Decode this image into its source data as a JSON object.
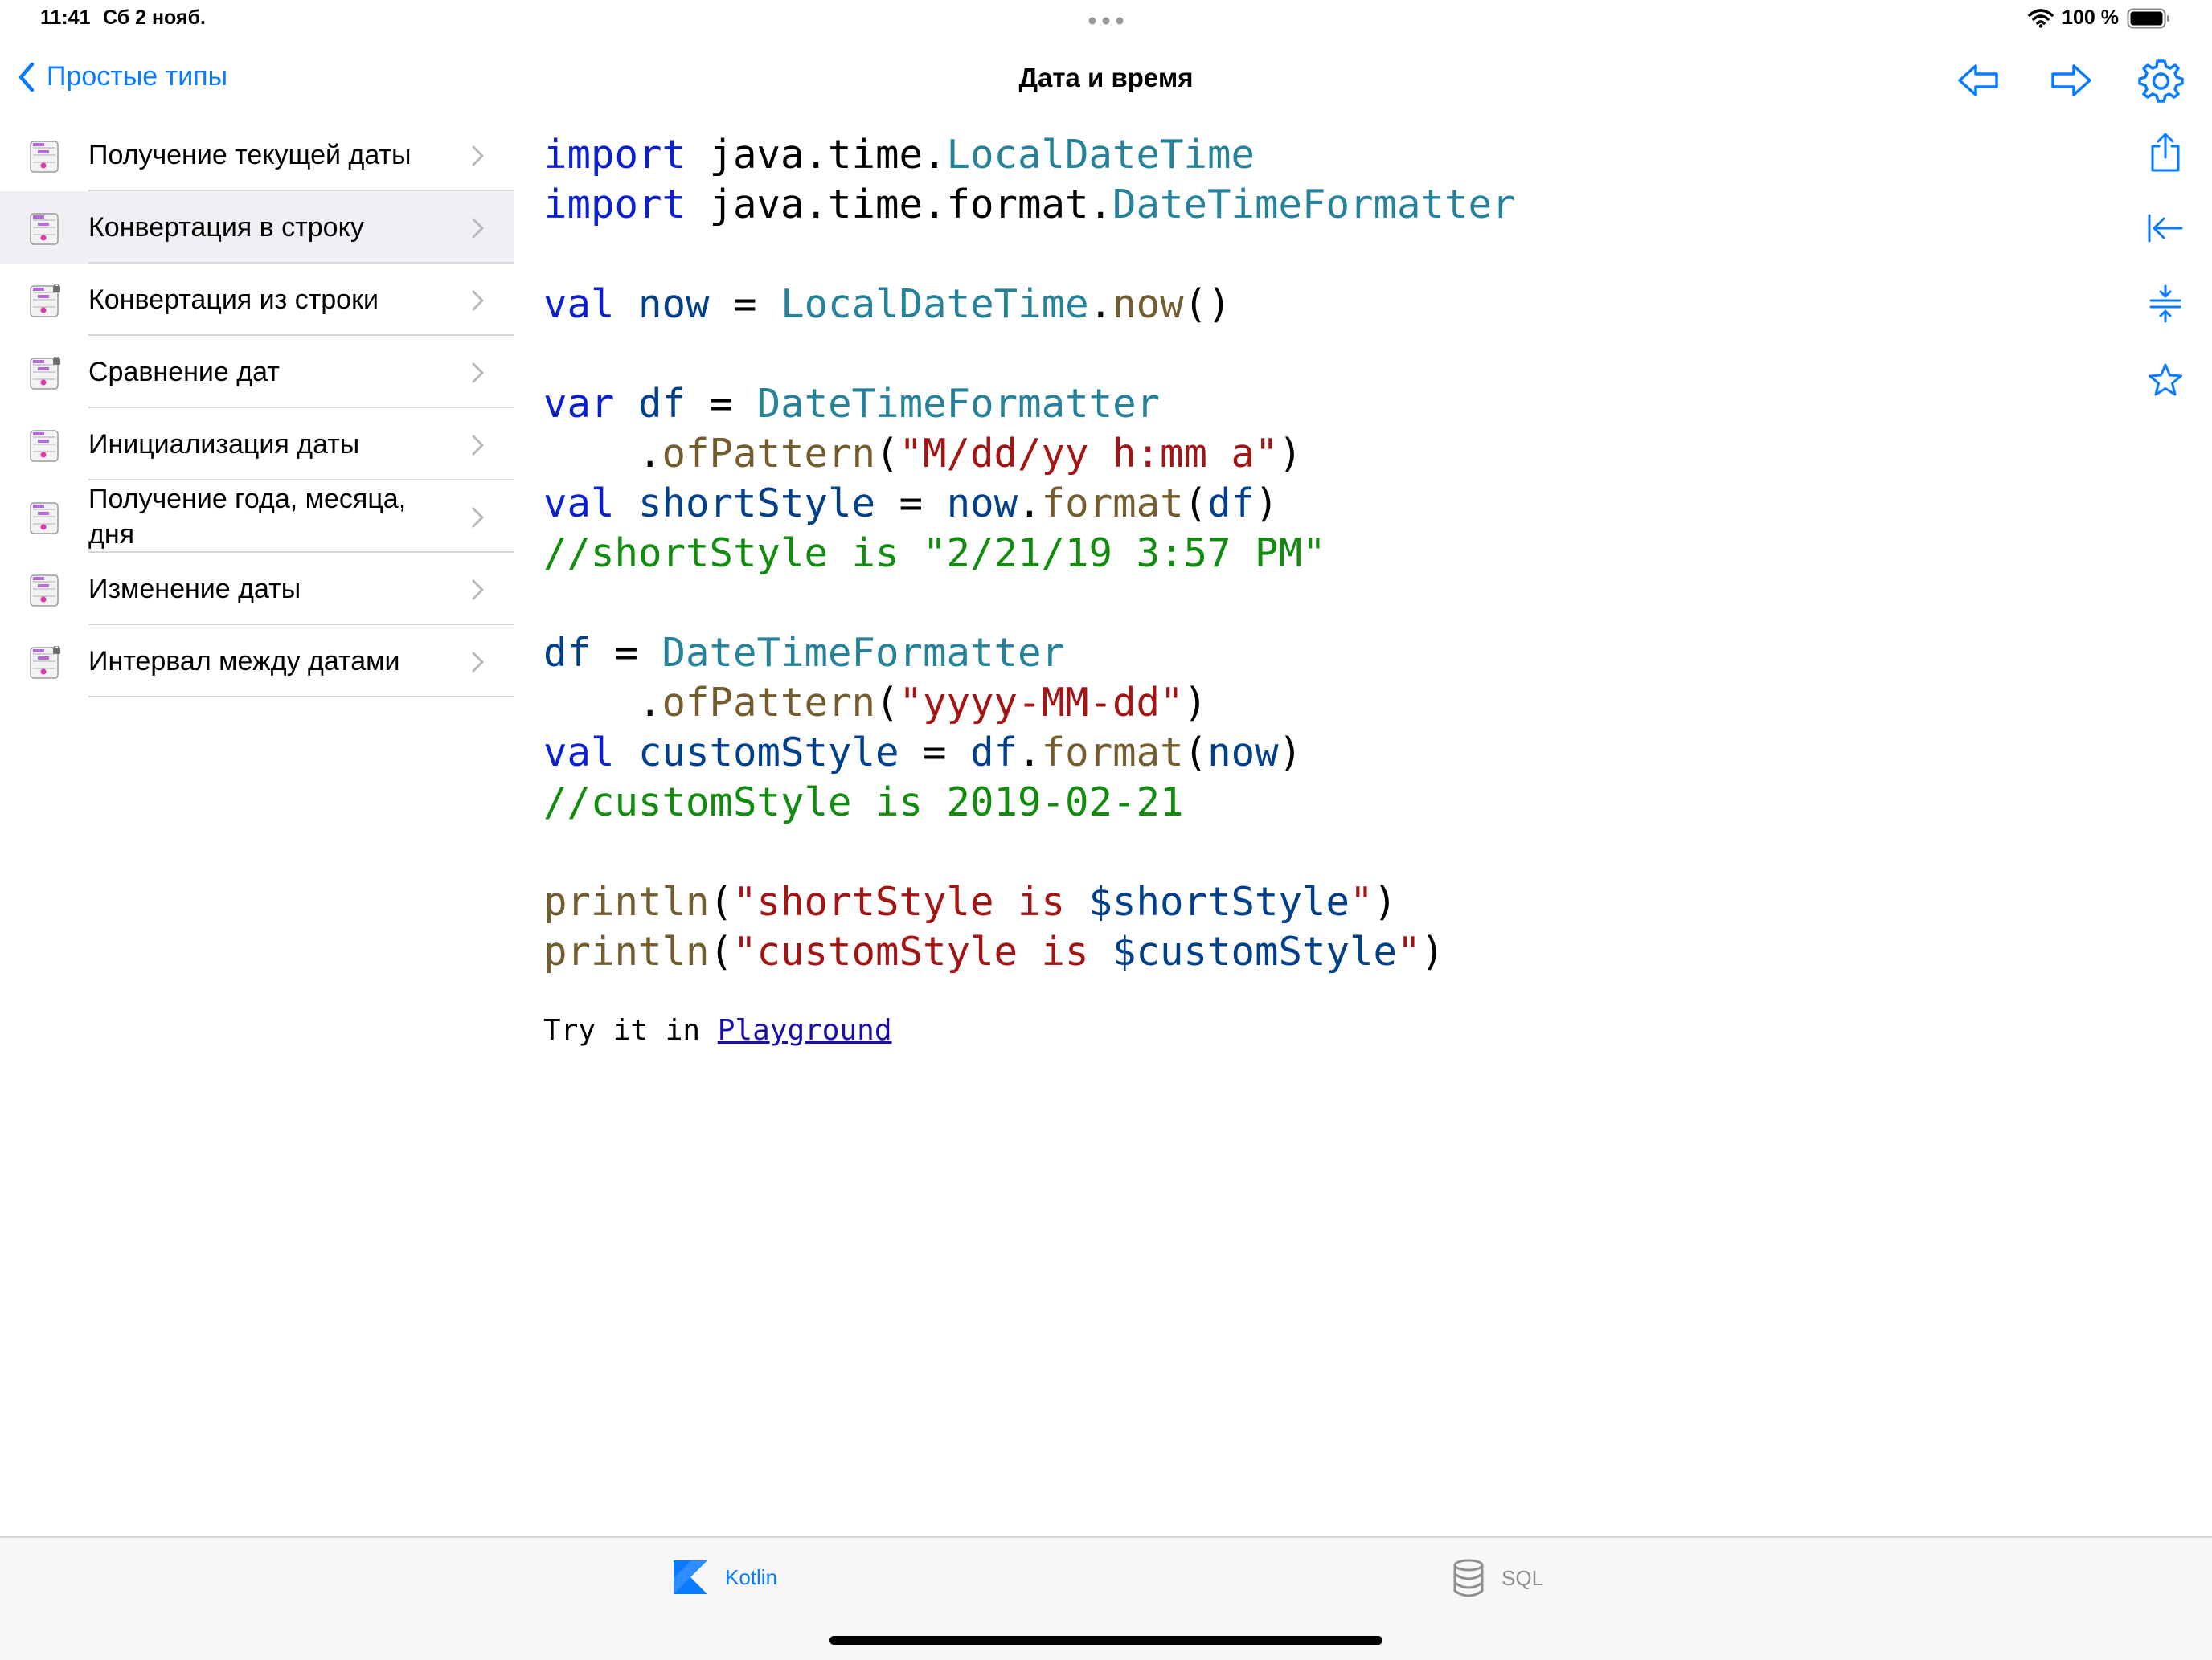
{
  "status": {
    "time": "11:41",
    "date": "Сб 2 нояб.",
    "battery": "100 %"
  },
  "nav": {
    "back_label": "Простые типы",
    "title": "Дата и время"
  },
  "colors": {
    "accent": "#0a7aff",
    "keyword": "#0b1fd0",
    "type": "#26829a",
    "function": "#735d2e",
    "string": "#a31515",
    "comment": "#128c0f",
    "identifier": "#003f8a"
  },
  "sidebar": {
    "items": [
      {
        "label": "Получение текущей даты",
        "locked": false,
        "selected": false
      },
      {
        "label": "Конвертация в строку",
        "locked": false,
        "selected": true
      },
      {
        "label": "Конвертация из строки",
        "locked": true,
        "selected": false
      },
      {
        "label": "Сравнение дат",
        "locked": true,
        "selected": false
      },
      {
        "label": "Инициализация даты",
        "locked": false,
        "selected": false
      },
      {
        "label": "Получение года, месяца, дня",
        "locked": false,
        "selected": false
      },
      {
        "label": "Изменение даты",
        "locked": false,
        "selected": false
      },
      {
        "label": "Интервал между датами",
        "locked": true,
        "selected": false
      }
    ]
  },
  "code": {
    "lines": [
      [
        [
          "kw",
          "import"
        ],
        [
          "pl",
          " java.time."
        ],
        [
          "ty",
          "LocalDateTime"
        ]
      ],
      [
        [
          "kw",
          "import"
        ],
        [
          "pl",
          " java.time.format."
        ],
        [
          "ty",
          "DateTimeFormatter"
        ]
      ],
      [],
      [
        [
          "kw",
          "val"
        ],
        [
          "pl",
          " "
        ],
        [
          "id",
          "now"
        ],
        [
          "pl",
          " = "
        ],
        [
          "ty",
          "LocalDateTime"
        ],
        [
          "pl",
          "."
        ],
        [
          "fn",
          "now"
        ],
        [
          "pl",
          "()"
        ]
      ],
      [],
      [
        [
          "kw",
          "var"
        ],
        [
          "pl",
          " "
        ],
        [
          "id",
          "df"
        ],
        [
          "pl",
          " = "
        ],
        [
          "ty",
          "DateTimeFormatter"
        ]
      ],
      [
        [
          "pl",
          "    ."
        ],
        [
          "fn",
          "ofPattern"
        ],
        [
          "pl",
          "("
        ],
        [
          "st",
          "\"M/dd/yy h:mm a\""
        ],
        [
          "pl",
          ")"
        ]
      ],
      [
        [
          "kw",
          "val"
        ],
        [
          "pl",
          " "
        ],
        [
          "id",
          "shortStyle"
        ],
        [
          "pl",
          " = "
        ],
        [
          "id",
          "now"
        ],
        [
          "pl",
          "."
        ],
        [
          "fn",
          "format"
        ],
        [
          "pl",
          "("
        ],
        [
          "id",
          "df"
        ],
        [
          "pl",
          ")"
        ]
      ],
      [
        [
          "cm",
          "//shortStyle is \"2/21/19 3:57 PM\""
        ]
      ],
      [],
      [
        [
          "id",
          "df"
        ],
        [
          "pl",
          " = "
        ],
        [
          "ty",
          "DateTimeFormatter"
        ]
      ],
      [
        [
          "pl",
          "    ."
        ],
        [
          "fn",
          "ofPattern"
        ],
        [
          "pl",
          "("
        ],
        [
          "st",
          "\"yyyy-MM-dd\""
        ],
        [
          "pl",
          ")"
        ]
      ],
      [
        [
          "kw",
          "val"
        ],
        [
          "pl",
          " "
        ],
        [
          "id",
          "customStyle"
        ],
        [
          "pl",
          " = "
        ],
        [
          "id",
          "df"
        ],
        [
          "pl",
          "."
        ],
        [
          "fn",
          "format"
        ],
        [
          "pl",
          "("
        ],
        [
          "id",
          "now"
        ],
        [
          "pl",
          ")"
        ]
      ],
      [
        [
          "cm",
          "//customStyle is 2019-02-21"
        ]
      ],
      [],
      [
        [
          "fn",
          "println"
        ],
        [
          "pl",
          "("
        ],
        [
          "st",
          "\"shortStyle is "
        ],
        [
          "id",
          "$shortStyle"
        ],
        [
          "st",
          "\""
        ],
        [
          "pl",
          ")"
        ]
      ],
      [
        [
          "fn",
          "println"
        ],
        [
          "pl",
          "("
        ],
        [
          "st",
          "\"customStyle is "
        ],
        [
          "id",
          "$customStyle"
        ],
        [
          "st",
          "\""
        ],
        [
          "pl",
          ")"
        ]
      ]
    ],
    "try_prefix": "Try it in ",
    "try_link": "Playground"
  },
  "right_toolbar": {
    "icons": [
      "share-icon",
      "collapse-left-icon",
      "split-icon",
      "star-icon"
    ]
  },
  "tabs": [
    {
      "label": "Kotlin",
      "icon": "kotlin-icon",
      "active": true
    },
    {
      "label": "SQL",
      "icon": "database-icon",
      "active": false
    }
  ]
}
